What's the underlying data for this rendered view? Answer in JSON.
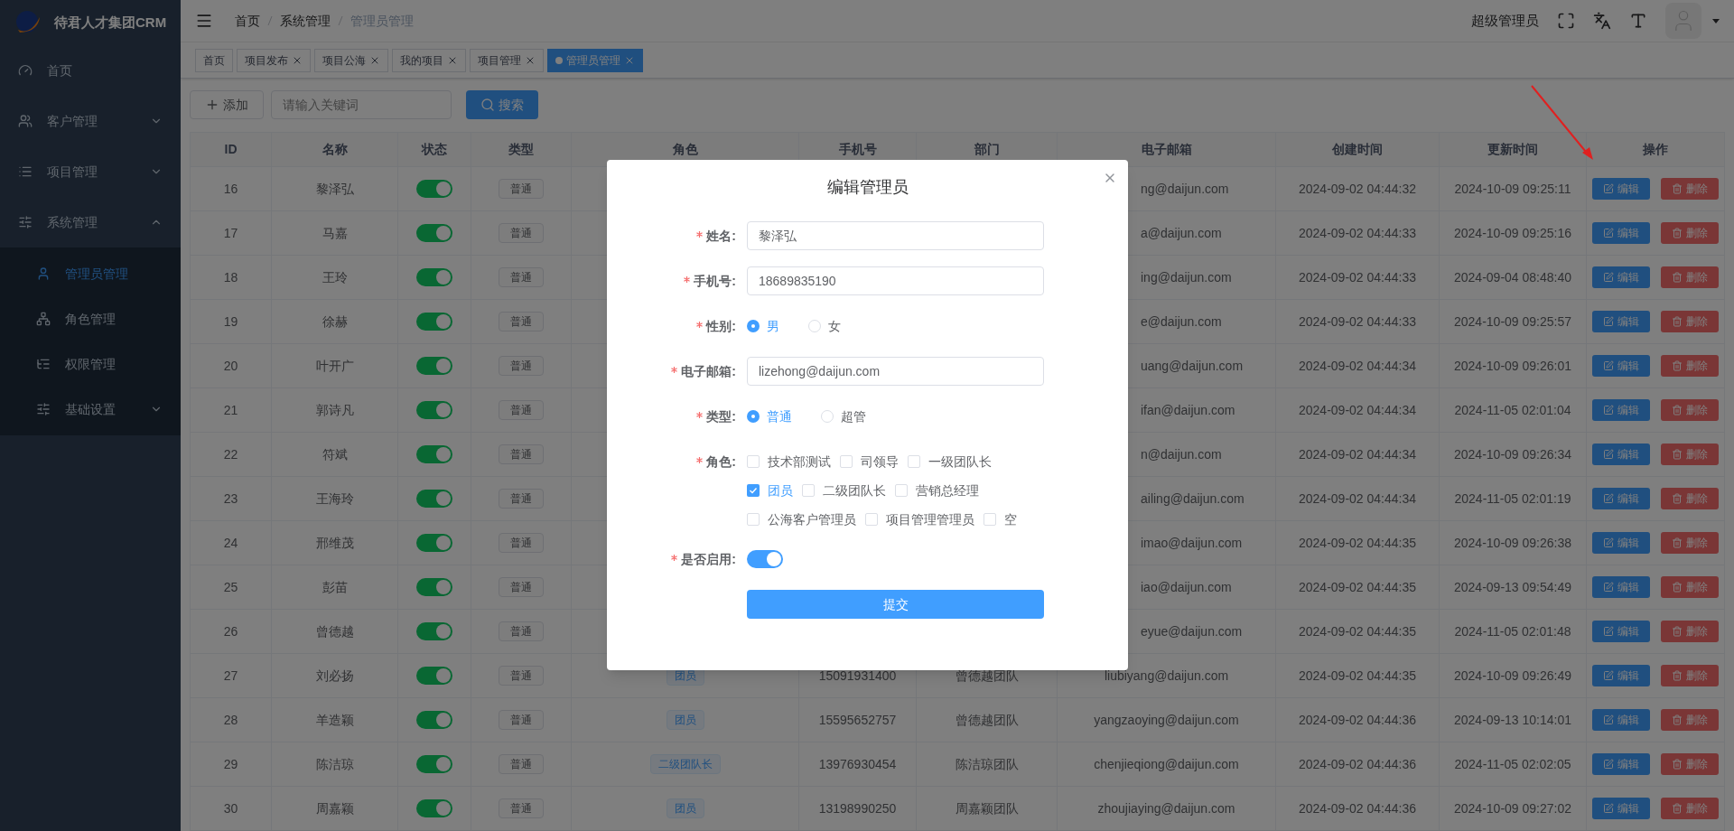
{
  "sidebar": {
    "logo_text": "待君人才集团CRM",
    "items": [
      {
        "label": "首页",
        "selected": false
      },
      {
        "label": "客户管理",
        "selected": false,
        "expanded": false
      },
      {
        "label": "项目管理",
        "selected": false,
        "expanded": false
      },
      {
        "label": "系统管理",
        "selected": false,
        "expanded": true,
        "children": [
          {
            "label": "管理员管理",
            "selected": true
          },
          {
            "label": "角色管理",
            "selected": false
          },
          {
            "label": "权限管理",
            "selected": false
          },
          {
            "label": "基础设置",
            "selected": false,
            "expanded": false
          }
        ]
      }
    ]
  },
  "header": {
    "breadcrumb": [
      {
        "label": "首页",
        "selected": false
      },
      {
        "label": "系统管理",
        "selected": false
      },
      {
        "label": "管理员管理",
        "selected": true
      }
    ],
    "user_name": "超级管理员"
  },
  "tabs": [
    {
      "label": "首页",
      "selected": false,
      "closable": false
    },
    {
      "label": "项目发布",
      "selected": false,
      "closable": true
    },
    {
      "label": "项目公海",
      "selected": false,
      "closable": true
    },
    {
      "label": "我的项目",
      "selected": false,
      "closable": true
    },
    {
      "label": "项目管理",
      "selected": false,
      "closable": true
    },
    {
      "label": "管理员管理",
      "selected": true,
      "closable": true
    }
  ],
  "toolbar": {
    "add_button": "添加",
    "search": {
      "placeholder": "请输入关键词"
    },
    "search_button": "搜索"
  },
  "table": {
    "columns": [
      "ID",
      "名称",
      "状态",
      "类型",
      "角色",
      "手机号",
      "部门",
      "电子邮箱",
      "创建时间",
      "更新时间",
      "操作"
    ],
    "rows": [
      {
        "kind": "covered",
        "id": "16",
        "name": "黎泽弘",
        "on": true,
        "type": "普通",
        "email": "ng@daijun.com",
        "created": "2024-09-02 04:44:32",
        "updated": "2024-10-09 09:25:11",
        "actions": [
          "编辑",
          "删除"
        ]
      },
      {
        "kind": "covered",
        "id": "17",
        "name": "马嘉",
        "on": true,
        "type": "普通",
        "email": "a@daijun.com",
        "created": "2024-09-02 04:44:33",
        "updated": "2024-10-09 09:25:16",
        "actions": [
          "编辑",
          "删除"
        ]
      },
      {
        "kind": "covered",
        "id": "18",
        "name": "王玲",
        "on": true,
        "type": "普通",
        "email": "ing@daijun.com",
        "created": "2024-09-02 04:44:33",
        "updated": "2024-09-04 08:48:40",
        "actions": [
          "编辑",
          "删除"
        ]
      },
      {
        "kind": "covered",
        "id": "19",
        "name": "徐赫",
        "on": true,
        "type": "普通",
        "email": "e@daijun.com",
        "created": "2024-09-02 04:44:33",
        "updated": "2024-10-09 09:25:57",
        "actions": [
          "编辑",
          "删除"
        ]
      },
      {
        "kind": "covered",
        "id": "20",
        "name": "叶开广",
        "on": true,
        "type": "普通",
        "email": "uang@daijun.com",
        "created": "2024-09-02 04:44:34",
        "updated": "2024-10-09 09:26:01",
        "actions": [
          "编辑",
          "删除"
        ]
      },
      {
        "kind": "covered",
        "id": "21",
        "name": "郭诗凡",
        "on": true,
        "type": "普通",
        "email": "ifan@daijun.com",
        "created": "2024-09-02 04:44:34",
        "updated": "2024-11-05 02:01:04",
        "actions": [
          "编辑",
          "删除"
        ]
      },
      {
        "kind": "covered",
        "id": "22",
        "name": "符斌",
        "on": true,
        "type": "普通",
        "email": "n@daijun.com",
        "created": "2024-09-02 04:44:34",
        "updated": "2024-10-09 09:26:34",
        "actions": [
          "编辑",
          "删除"
        ]
      },
      {
        "kind": "covered",
        "id": "23",
        "name": "王海玲",
        "on": true,
        "type": "普通",
        "email": "ailing@daijun.com",
        "created": "2024-09-02 04:44:34",
        "updated": "2024-11-05 02:01:19",
        "actions": [
          "编辑",
          "删除"
        ]
      },
      {
        "kind": "covered",
        "id": "24",
        "name": "邢维茂",
        "on": true,
        "type": "普通",
        "email": "imao@daijun.com",
        "created": "2024-09-02 04:44:35",
        "updated": "2024-10-09 09:26:38",
        "actions": [
          "编辑",
          "删除"
        ]
      },
      {
        "kind": "covered",
        "id": "25",
        "name": "彭苗",
        "on": true,
        "type": "普通",
        "email": "iao@daijun.com",
        "created": "2024-09-02 04:44:35",
        "updated": "2024-09-13 09:54:49",
        "actions": [
          "编辑",
          "删除"
        ]
      },
      {
        "kind": "covered",
        "id": "26",
        "name": "曾德越",
        "on": true,
        "type": "普通",
        "email": "eyue@daijun.com",
        "created": "2024-09-02 04:44:35",
        "updated": "2024-11-05 02:01:48",
        "actions": [
          "编辑",
          "删除"
        ]
      },
      {
        "kind": "plain",
        "id": "27",
        "name": "刘必扬",
        "on": true,
        "type": "普通",
        "role": "团员",
        "phone": "15091931400",
        "dept": "曾德越团队",
        "email": "liubiyang@daijun.com",
        "created": "2024-09-02 04:44:35",
        "updated": "2024-10-09 09:26:49",
        "actions": [
          "编辑",
          "删除"
        ]
      },
      {
        "kind": "plain",
        "id": "28",
        "name": "羊造颖",
        "on": true,
        "type": "普通",
        "role": "团员",
        "phone": "15595652757",
        "dept": "曾德越团队",
        "email": "yangzaoying@daijun.com",
        "created": "2024-09-02 04:44:36",
        "updated": "2024-09-13 10:14:01",
        "actions": [
          "编辑",
          "删除"
        ]
      },
      {
        "kind": "plain",
        "id": "29",
        "name": "陈洁琼",
        "on": true,
        "type": "普通",
        "role": "二级团队长",
        "phone": "13976930454",
        "dept": "陈洁琼团队",
        "email": "chenjieqiong@daijun.com",
        "created": "2024-09-02 04:44:36",
        "updated": "2024-11-05 02:02:05",
        "actions": [
          "编辑",
          "删除"
        ]
      },
      {
        "kind": "plain",
        "id": "30",
        "name": "周嘉颖",
        "on": true,
        "type": "普通",
        "role": "团员",
        "phone": "13198990250",
        "dept": "周嘉颖团队",
        "email": "zhoujiaying@daijun.com",
        "created": "2024-09-02 04:44:36",
        "updated": "2024-10-09 09:27:02",
        "actions": [
          "编辑",
          "删除"
        ]
      }
    ]
  },
  "dialog": {
    "title": "编辑管理员",
    "fields": [
      {
        "kind": "text",
        "label": "姓名:",
        "required": true,
        "value": "黎泽弘"
      },
      {
        "kind": "text",
        "label": "手机号:",
        "required": true,
        "value": "18689835190"
      },
      {
        "kind": "radio",
        "label": "性别:",
        "required": true,
        "options": [
          {
            "label": "男",
            "selected": true
          },
          {
            "label": "女",
            "selected": false
          }
        ]
      },
      {
        "kind": "text",
        "label": "电子邮箱:",
        "required": true,
        "value": "lizehong@daijun.com"
      },
      {
        "kind": "radio",
        "label": "类型:",
        "required": true,
        "options": [
          {
            "label": "普通",
            "selected": true
          },
          {
            "label": "超管",
            "selected": false
          }
        ]
      },
      {
        "kind": "checkbox",
        "label": "角色:",
        "required": true,
        "option_rows": [
          [
            {
              "label": "技术部测试",
              "checked": false
            },
            {
              "label": "司领导",
              "checked": false
            },
            {
              "label": "一级团队长",
              "checked": false
            }
          ],
          [
            {
              "label": "团员",
              "checked": true
            },
            {
              "label": "二级团队长",
              "checked": false
            },
            {
              "label": "营销总经理",
              "checked": false
            }
          ],
          [
            {
              "label": "公海客户管理员",
              "checked": false
            },
            {
              "label": "项目管理管理员",
              "checked": false
            },
            {
              "label": "空",
              "checked": false
            }
          ]
        ]
      },
      {
        "kind": "switch",
        "label": "是否启用:",
        "required": true,
        "on": true
      }
    ],
    "submit": "提交"
  }
}
